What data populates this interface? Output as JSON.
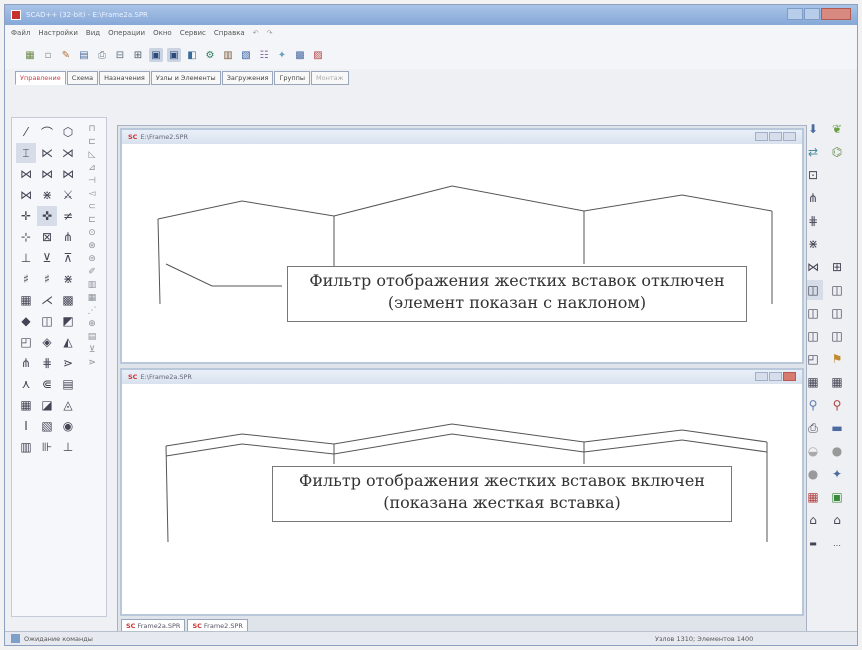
{
  "window": {
    "title": "SCAD++ (32-bit) - E:\\Frame2a.SPR"
  },
  "menu": {
    "items": [
      "Файл",
      "Настройки",
      "Вид",
      "Операции",
      "Окно",
      "Сервис",
      "Справка"
    ]
  },
  "toolbar": {
    "icons": [
      "grid-icon",
      "pointer-icon",
      "node-icon",
      "table-icon",
      "print-icon",
      "frame-icon",
      "scheme-icon",
      "view-icon",
      "filter-icon",
      "edit-icon",
      "link-icon",
      "chart-icon",
      "save-icon",
      "settings-icon",
      "render-icon"
    ]
  },
  "tabs": [
    {
      "label": "Управление",
      "state": "active"
    },
    {
      "label": "Схема",
      "state": "normal"
    },
    {
      "label": "Назначения",
      "state": "normal"
    },
    {
      "label": "Узлы и Элементы",
      "state": "normal"
    },
    {
      "label": "Загружения",
      "state": "normal"
    },
    {
      "label": "Группы",
      "state": "normal"
    },
    {
      "label": "Монтаж",
      "state": "disabled"
    }
  ],
  "documents": {
    "top": {
      "title": "E:\\Frame2.SPR",
      "note_line1": "Фильтр отображения жестких вставок отключен",
      "note_line2": "(элемент показан с наклоном)"
    },
    "bottom": {
      "title": "E:\\Frame2a.SPR",
      "note_line1": "Фильтр отображения жестких вставок включен",
      "note_line2": "(показана жесткая вставка)"
    }
  },
  "doc_tabs": [
    {
      "label": "Frame2a.SPR"
    },
    {
      "label": "Frame2.SPR"
    }
  ],
  "status": {
    "left": "Ожидание команды",
    "right": "Узлов 1310; Элементов 1400"
  },
  "colors": {
    "active_tab": "#d24040",
    "title_gradient": "#86a8d8",
    "close_button": "#d77a70"
  }
}
